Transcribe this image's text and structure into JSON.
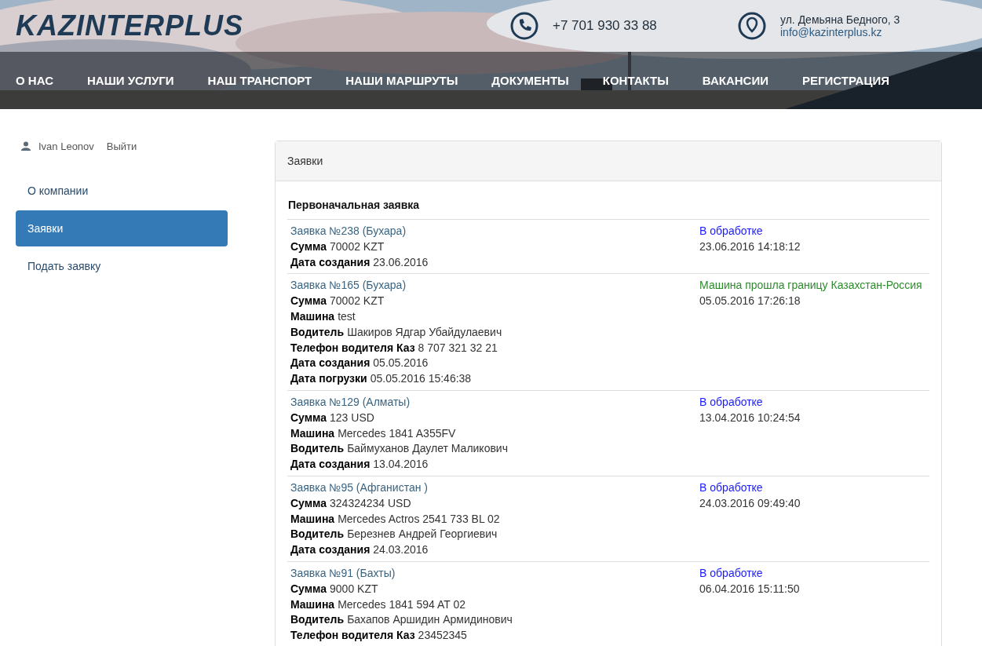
{
  "header": {
    "logo": "KAZINTERPLUS",
    "phone": "+7 701 930 33 88",
    "address": "ул. Демьяна Бедного, 3",
    "email": "info@kazinterplus.kz"
  },
  "nav": [
    "О НАС",
    "НАШИ УСЛУГИ",
    "НАШ ТРАНСПОРТ",
    "НАШИ МАРШРУТЫ",
    "ДОКУМЕНТЫ",
    "КОНТАКТЫ",
    "ВАКАНСИИ",
    "РЕГИСТРАЦИЯ"
  ],
  "user": {
    "name": "Ivan Leonov",
    "logout": "Выйти"
  },
  "sidebar": {
    "items": [
      {
        "label": "О компании",
        "selected": false
      },
      {
        "label": "Заявки",
        "selected": true
      },
      {
        "label": "Подать заявку",
        "selected": false
      }
    ]
  },
  "panel": {
    "title": "Заявки",
    "section": "Первоначальная заявка",
    "orders": [
      {
        "title": "Заявка №238 (Бухара)",
        "fields": [
          {
            "label": "Сумма",
            "value": "70002 KZT"
          },
          {
            "label": "Дата создания",
            "value": "23.06.2016"
          }
        ],
        "status": {
          "text": "В обработке",
          "color": "#1a1aff"
        },
        "datetime": "23.06.2016 14:18:12"
      },
      {
        "title": "Заявка №165 (Бухара)",
        "fields": [
          {
            "label": "Сумма",
            "value": "70002 KZT"
          },
          {
            "label": "Машина",
            "value": "test"
          },
          {
            "label": "Водитель",
            "value": "Шакиров Ядгар Убайдулаевич"
          },
          {
            "label": "Телефон водителя Каз",
            "value": "8 707 321 32 21"
          },
          {
            "label": "Дата создания",
            "value": "05.05.2016"
          },
          {
            "label": "Дата погрузки",
            "value": "05.05.2016 15:46:38"
          }
        ],
        "status": {
          "text": "Машина прошла границу Казахстан-Россия",
          "color": "#2e8b2e"
        },
        "datetime": "05.05.2016 17:26:18"
      },
      {
        "title": "Заявка №129 (Алматы)",
        "fields": [
          {
            "label": "Сумма",
            "value": "123 USD"
          },
          {
            "label": "Машина",
            "value": "Mercedes 1841 A355FV"
          },
          {
            "label": "Водитель",
            "value": "Баймуханов Даулет Маликович"
          },
          {
            "label": "Дата создания",
            "value": "13.04.2016"
          }
        ],
        "status": {
          "text": "В обработке",
          "color": "#1a1aff"
        },
        "datetime": "13.04.2016 10:24:54"
      },
      {
        "title": "Заявка №95 (Афганистан )",
        "fields": [
          {
            "label": "Сумма",
            "value": "324324234 USD"
          },
          {
            "label": "Машина",
            "value": "Mercedes Actros 2541 733 BL 02"
          },
          {
            "label": "Водитель",
            "value": "Березнев Андрей Георгиевич"
          },
          {
            "label": "Дата создания",
            "value": "24.03.2016"
          }
        ],
        "status": {
          "text": "В обработке",
          "color": "#1a1aff"
        },
        "datetime": "24.03.2016 09:49:40"
      },
      {
        "title": "Заявка №91 (Бахты)",
        "fields": [
          {
            "label": "Сумма",
            "value": "9000 KZT"
          },
          {
            "label": "Машина",
            "value": "Mercedes 1841 594 AT 02"
          },
          {
            "label": "Водитель",
            "value": "Бахапов Аршидин Армидинович"
          },
          {
            "label": "Телефон водителя Каз",
            "value": "23452345"
          }
        ],
        "status": {
          "text": "В обработке",
          "color": "#1a1aff"
        },
        "datetime": "06.04.2016 15:11:50"
      }
    ]
  }
}
